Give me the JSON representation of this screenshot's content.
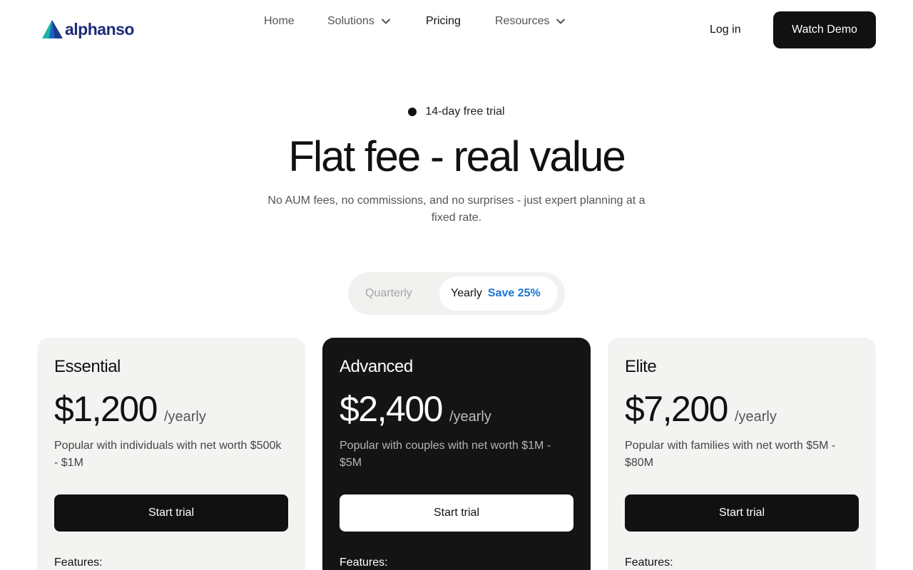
{
  "brand": {
    "name": "alphanso",
    "logo_icon": "triangle-logo-icon",
    "colors": {
      "logo_blue": "#1e2c78",
      "accent": "#1a76d2"
    }
  },
  "nav": {
    "items": [
      {
        "label": "Home",
        "has_dropdown": false,
        "active": false
      },
      {
        "label": "Solutions",
        "has_dropdown": true,
        "active": false
      },
      {
        "label": "Pricing",
        "has_dropdown": false,
        "active": true
      },
      {
        "label": "Resources",
        "has_dropdown": true,
        "active": false
      }
    ],
    "login_label": "Log in",
    "demo_label": "Watch Demo"
  },
  "hero": {
    "badge": "14-day free trial",
    "title": "Flat fee - real value",
    "subtitle": "No AUM fees, no commissions, and no surprises - just expert planning at a fixed rate."
  },
  "billing_toggle": {
    "quarterly_label": "Quarterly",
    "yearly_label": "Yearly",
    "yearly_badge": "Save 25%",
    "selected": "Yearly"
  },
  "plans": [
    {
      "name": "Essential",
      "price": "$1,200",
      "period": "/yearly",
      "description": "Popular with individuals with net worth $500k - $1M",
      "cta": "Start trial",
      "features_label": "Features:",
      "theme": "light"
    },
    {
      "name": "Advanced",
      "price": "$2,400",
      "period": "/yearly",
      "description": "Popular with couples with net worth $1M - $5M",
      "cta": "Start trial",
      "features_label": "Features:",
      "theme": "dark"
    },
    {
      "name": "Elite",
      "price": "$7,200",
      "period": "/yearly",
      "description": "Popular with families with net worth $5M - $80M",
      "cta": "Start trial",
      "features_label": "Features:",
      "theme": "light"
    }
  ]
}
